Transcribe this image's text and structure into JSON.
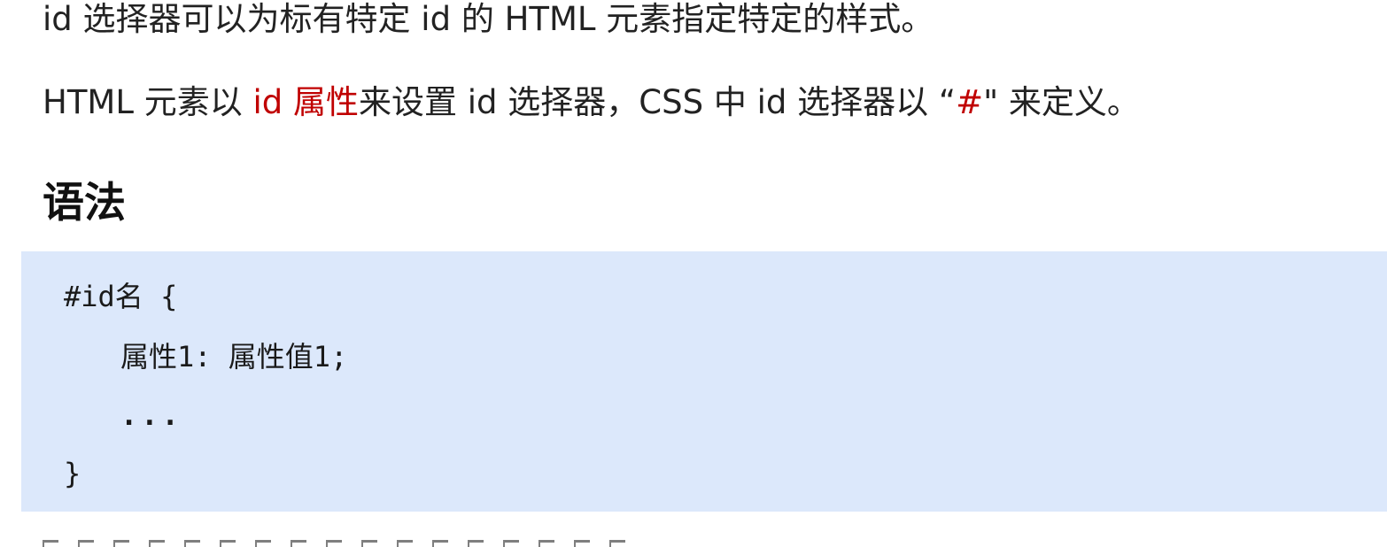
{
  "intro": {
    "paragraph_1": "id 选择器可以为标有特定 id 的 HTML 元素指定特定的样式。",
    "paragraph_2": {
      "part_1": "HTML 元素以 ",
      "highlight_1": "id 属性",
      "part_2": "来设置 id 选择器，CSS 中 id 选择器以 “",
      "highlight_2": "#",
      "part_3": "\" 来定义。"
    }
  },
  "syntax": {
    "heading": "语法",
    "code_lines": [
      "#id名 {",
      "属性1: 属性值1;",
      "...",
      "}"
    ]
  },
  "colors": {
    "highlight": "#c00000",
    "code_background": "#dce8fb",
    "text": "#222222"
  }
}
